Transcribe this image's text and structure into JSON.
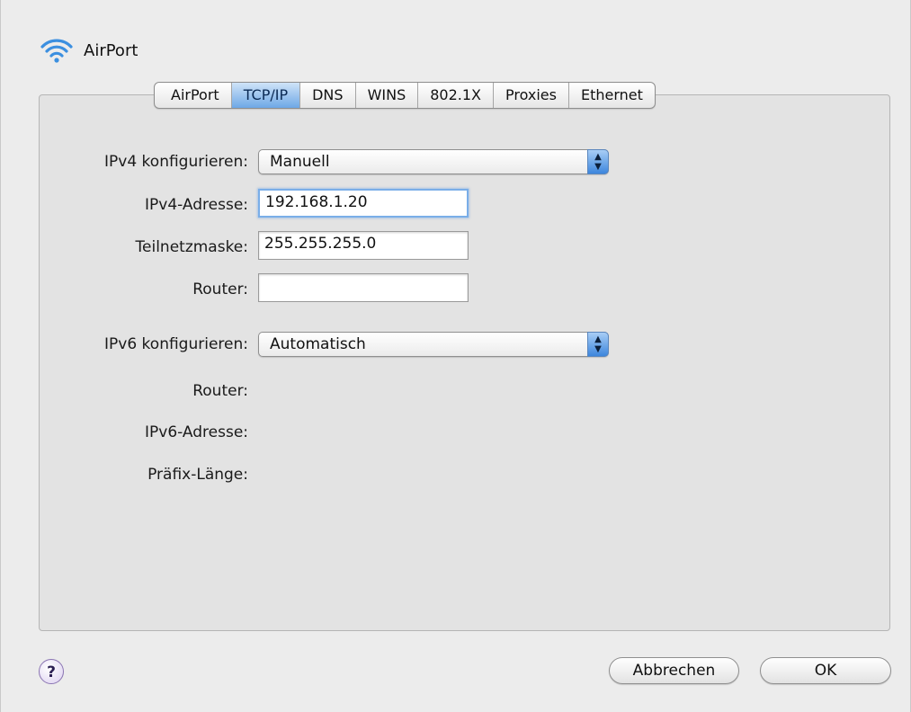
{
  "header": {
    "title": "AirPort",
    "icon": "wifi-icon"
  },
  "tabs": [
    {
      "label": "AirPort"
    },
    {
      "label": "TCP/IP",
      "selected": true
    },
    {
      "label": "DNS"
    },
    {
      "label": "WINS"
    },
    {
      "label": "802.1X"
    },
    {
      "label": "Proxies"
    },
    {
      "label": "Ethernet"
    }
  ],
  "ipv4": {
    "configure_label": "IPv4 konfigurieren:",
    "configure_value": "Manuell",
    "address_label": "IPv4-Adresse:",
    "address_value": "192.168.1.20",
    "subnet_label": "Teilnetzmaske:",
    "subnet_value": "255.255.255.0",
    "router_label": "Router:",
    "router_value": ""
  },
  "ipv6": {
    "configure_label": "IPv6 konfigurieren:",
    "configure_value": "Automatisch",
    "router_label": "Router:",
    "address_label": "IPv6-Adresse:",
    "prefix_label": "Präfix-Länge:"
  },
  "footer": {
    "help_label": "?",
    "cancel_label": "Abbrechen",
    "ok_label": "OK"
  },
  "colors": {
    "selected_tab": "#6ea8e6",
    "popup_stepper": "#3d86dd",
    "focus_ring": "#7aaee8",
    "background": "#ececec"
  }
}
